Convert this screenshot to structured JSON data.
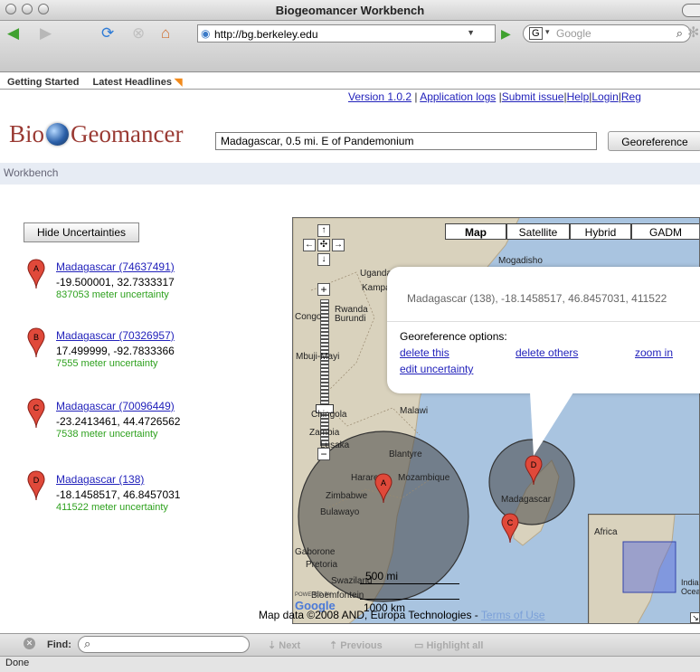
{
  "window": {
    "title": "Biogeomancer Workbench"
  },
  "browser": {
    "url": "http://bg.berkeley.edu",
    "search_engine_label": "Google",
    "bookmarks": [
      "Getting Started",
      "Latest Headlines"
    ]
  },
  "header": {
    "links": [
      "Version 1.0.2",
      "Application logs",
      "Submit issue",
      "Help",
      "Login",
      "Reg"
    ],
    "separator": "|",
    "logo_left": "Bio",
    "logo_right": "Geomancer",
    "query_value": "Madagascar, 0.5 mi. E of Pandemonium",
    "georeference_button": "Georeference"
  },
  "workbench_label": "Workbench",
  "sidebar": {
    "hide_uncertainties_button": "Hide Uncertainties",
    "records": [
      {
        "marker": "A",
        "link": "Madagascar (74637491)",
        "coords": "-19.500001, 32.7333317",
        "uncertainty": "837053 meter uncertainty"
      },
      {
        "marker": "B",
        "link": "Madagascar (70326957)",
        "coords": "17.499999, -92.7833366",
        "uncertainty": "7555 meter uncertainty"
      },
      {
        "marker": "C",
        "link": "Madagascar (70096449)",
        "coords": "-23.2413461, 44.4726562",
        "uncertainty": "7538 meter uncertainty"
      },
      {
        "marker": "D",
        "link": "Madagascar (138)",
        "coords": "-18.1458517, 46.8457031",
        "uncertainty": "411522 meter uncertainty"
      }
    ]
  },
  "map": {
    "types": [
      "Map",
      "Satellite",
      "Hybrid",
      "GADM"
    ],
    "active_type": "Map",
    "zoom_in": "+",
    "zoom_out": "−",
    "pan_up": "↑",
    "pan_down": "↓",
    "pan_left": "←",
    "pan_right": "→",
    "place_labels": [
      "Mogadisho",
      "Uganda",
      "Kampala",
      "Rwanda",
      "Burundi",
      "Congo",
      "Mbuji-Mayi",
      "Chingola",
      "Zambia",
      "Lusaka",
      "Malawi",
      "Blantyre",
      "Harare",
      "Mozambique",
      "Zimbabwe",
      "Bulawayo",
      "Madagascar",
      "Gaborone",
      "Pretoria",
      "Swaziland",
      "Bloemfontein",
      "Africa",
      "Indian Ocean"
    ],
    "marker_labels": [
      "A",
      "C",
      "D"
    ],
    "scale": "500 mi",
    "scale_km": "1000 km",
    "powered_by": "POWERED BY",
    "attribution": "Map data ©2008 AND, Europa Technologies -",
    "terms_link": "Terms of Use",
    "info_bubble": {
      "heading": "Madagascar (138), -18.1458517, 46.8457031, 411522",
      "options_label": "Georeference options:",
      "links": [
        "delete this",
        "delete others",
        "zoom in",
        "edit uncertainty"
      ]
    }
  },
  "findbar": {
    "label": "Find:",
    "next": "Next",
    "previous": "Previous",
    "highlight": "Highlight all"
  },
  "status": "Done",
  "colors": {
    "accent": "#2222bb",
    "uncertainty_text": "#2ea11e",
    "marker": "#e0493a",
    "logo": "#9a3a33"
  }
}
